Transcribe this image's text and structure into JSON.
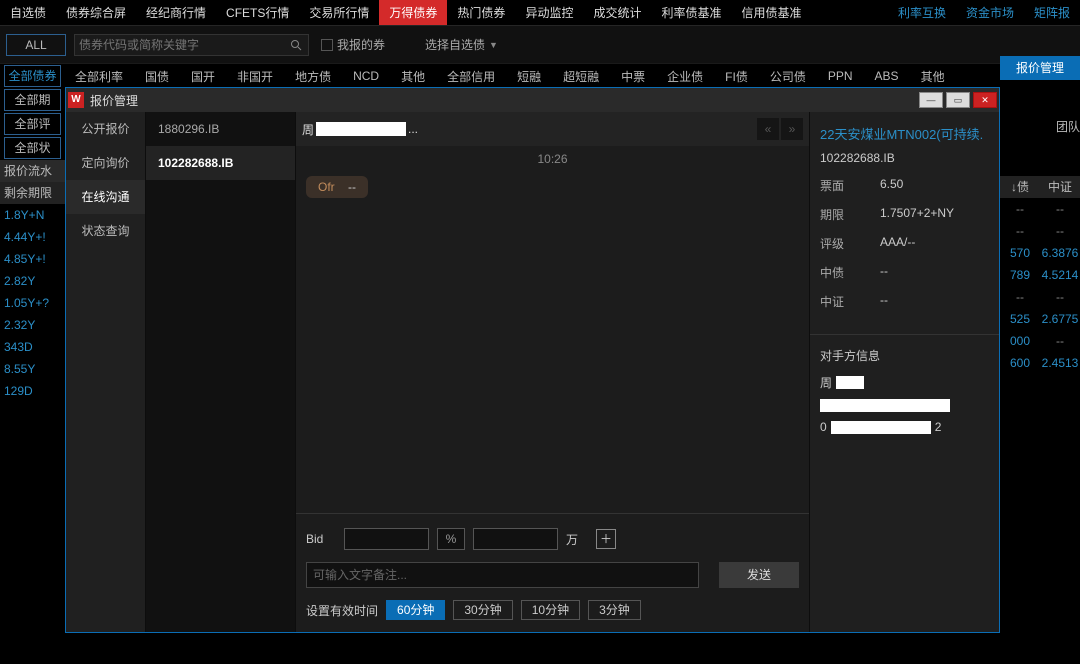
{
  "topnav": {
    "items": [
      "自选债",
      "债券综合屏",
      "经纪商行情",
      "CFETS行情",
      "交易所行情",
      "万得债券",
      "热门债券",
      "异动监控",
      "成交统计",
      "利率债基准",
      "信用债基准"
    ],
    "active_index": 5,
    "right_items": [
      "利率互换",
      "资金市场",
      "矩阵报"
    ]
  },
  "row2": {
    "all_btn": "ALL",
    "search_placeholder": "债券代码或简称关键字",
    "checkbox_label": "我报的券",
    "select_label": "选择自选债"
  },
  "row3": {
    "left_buttons": [
      "全部债券",
      "全部期",
      "全部评",
      "全部状"
    ],
    "filters": [
      "全部利率",
      "国债",
      "国开",
      "非国开",
      "地方债",
      "NCD",
      "其他",
      "全部信用",
      "短融",
      "超短融",
      "中票",
      "企业债",
      "FI债",
      "公司债",
      "PPN",
      "ABS",
      "其他"
    ]
  },
  "action_button": "报价管理",
  "leftstub": {
    "headers": [
      "报价流水",
      "剩余期限"
    ],
    "rows": [
      "1.8Y+N",
      "4.44Y+!",
      "4.85Y+!",
      "2.82Y",
      "1.05Y+?",
      "2.32Y",
      "343D",
      "8.55Y",
      "129D "
    ]
  },
  "rightstub": {
    "team_label": "团队",
    "headers": [
      "↓债",
      "中证"
    ],
    "rows": [
      [
        "--",
        "--"
      ],
      [
        "--",
        "--"
      ],
      [
        "570",
        "6.3876"
      ],
      [
        "789",
        "4.5214"
      ],
      [
        "--",
        "--"
      ],
      [
        "525",
        "2.6775"
      ],
      [
        "000",
        "--"
      ],
      [
        "600",
        "2.4513"
      ]
    ]
  },
  "modal": {
    "title": "报价管理",
    "logo_letter": "W",
    "nav": [
      "公开报价",
      "定向询价",
      "在线沟通",
      "状态查询"
    ],
    "nav_active": 2,
    "list": [
      "1880296.IB",
      "102282688.IB"
    ],
    "list_active": 1,
    "center": {
      "contact_prefix": "周",
      "contact_suffix": "...",
      "time": "10:26",
      "bubble_label": "Ofr",
      "bubble_value": "--",
      "bid_label": "Bid",
      "percent_label": "%",
      "unit_label": "万",
      "remark_placeholder": "可输入文字备注...",
      "send_label": "发送",
      "time_label": "设置有效时间",
      "time_options": [
        "60分钟",
        "30分钟",
        "10分钟",
        "3分钟"
      ],
      "time_active": 0
    },
    "right": {
      "bond_name": "22天安煤业MTN002(可持续.",
      "bond_code": "102282688.IB",
      "fields": [
        {
          "k": "票面",
          "v": "6.50"
        },
        {
          "k": "期限",
          "v": "1.7507+2+NY"
        },
        {
          "k": "评级",
          "v": "AAA/--"
        },
        {
          "k": "中债",
          "v": "--"
        },
        {
          "k": "中证",
          "v": "--"
        }
      ],
      "counterparty_title": "对手方信息",
      "cp_name_prefix": "周",
      "cp_line3_prefix": "0",
      "cp_line3_suffix": "2"
    }
  }
}
